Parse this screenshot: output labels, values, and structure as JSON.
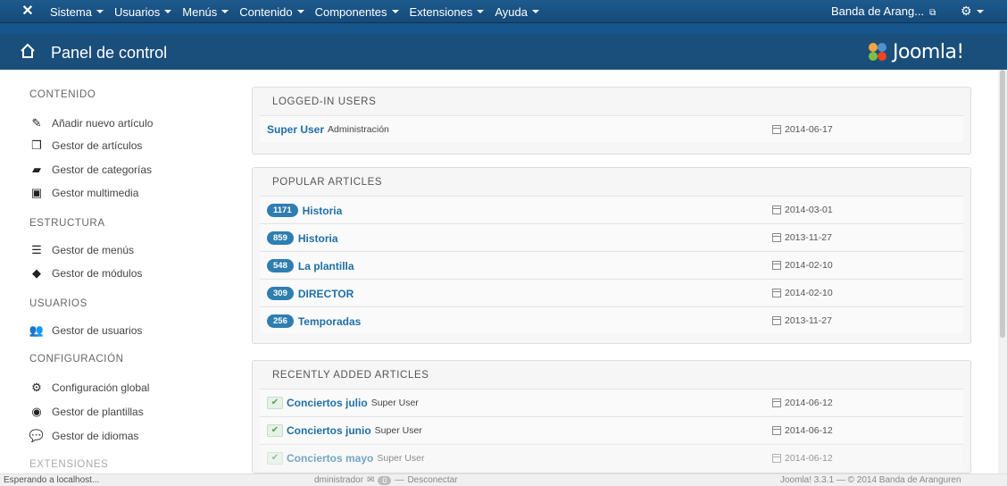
{
  "navbar": {
    "menu": [
      {
        "label": "Sistema"
      },
      {
        "label": "Usuarios"
      },
      {
        "label": "Menús"
      },
      {
        "label": "Contenido"
      },
      {
        "label": "Componentes"
      },
      {
        "label": "Extensiones"
      },
      {
        "label": "Ayuda"
      }
    ],
    "site_name": "Banda de Arang...",
    "gear_icon": "gear-icon"
  },
  "header": {
    "title": "Panel de control",
    "brand": "Joomla!"
  },
  "sidebar": {
    "sections": [
      {
        "title": "CONTENIDO",
        "items": [
          {
            "label": "Añadir nuevo artículo",
            "icon": "pencil-icon"
          },
          {
            "label": "Gestor de artículos",
            "icon": "copy-icon"
          },
          {
            "label": "Gestor de categorías",
            "icon": "folder-icon"
          },
          {
            "label": "Gestor multimedia",
            "icon": "image-icon"
          }
        ]
      },
      {
        "title": "ESTRUCTURA",
        "items": [
          {
            "label": "Gestor de menús",
            "icon": "list-icon"
          },
          {
            "label": "Gestor de módulos",
            "icon": "cube-icon"
          }
        ]
      },
      {
        "title": "USUARIOS",
        "items": [
          {
            "label": "Gestor de usuarios",
            "icon": "users-icon"
          }
        ]
      },
      {
        "title": "CONFIGURACIÓN",
        "items": [
          {
            "label": "Configuración global",
            "icon": "cog-icon"
          },
          {
            "label": "Gestor de plantillas",
            "icon": "eye-icon"
          },
          {
            "label": "Gestor de idiomas",
            "icon": "comments-icon"
          }
        ]
      },
      {
        "title": "EXTENSIONES",
        "items": []
      }
    ]
  },
  "panels": {
    "logged_in": {
      "title": "LOGGED-IN USERS",
      "rows": [
        {
          "name": "Super User",
          "meta": "Administración",
          "date": "2014-06-17"
        }
      ]
    },
    "popular": {
      "title": "POPULAR ARTICLES",
      "rows": [
        {
          "hits": "1171",
          "title": "Historia",
          "date": "2014-03-01"
        },
        {
          "hits": "859",
          "title": "Historia",
          "date": "2013-11-27"
        },
        {
          "hits": "548",
          "title": "La plantilla",
          "date": "2014-02-10"
        },
        {
          "hits": "309",
          "title": "DIRECTOR",
          "date": "2014-02-10"
        },
        {
          "hits": "256",
          "title": "Temporadas",
          "date": "2013-11-27"
        }
      ]
    },
    "recent": {
      "title": "RECENTLY ADDED ARTICLES",
      "rows": [
        {
          "title": "Conciertos julio",
          "author": "Super User",
          "date": "2014-06-12"
        },
        {
          "title": "Conciertos junio",
          "author": "Super User",
          "date": "2014-06-12"
        },
        {
          "title": "Conciertos mayo",
          "author": "Super User",
          "date": "2014-06-12"
        }
      ]
    }
  },
  "footer": {
    "status": "Esperando a localhost...",
    "user_prefix": "dministrador",
    "messages_count": "0",
    "logout": "Desconectar",
    "version": "Joomla! 3.3.1",
    "copyright": "— © 2014 Banda de Aranguren"
  }
}
